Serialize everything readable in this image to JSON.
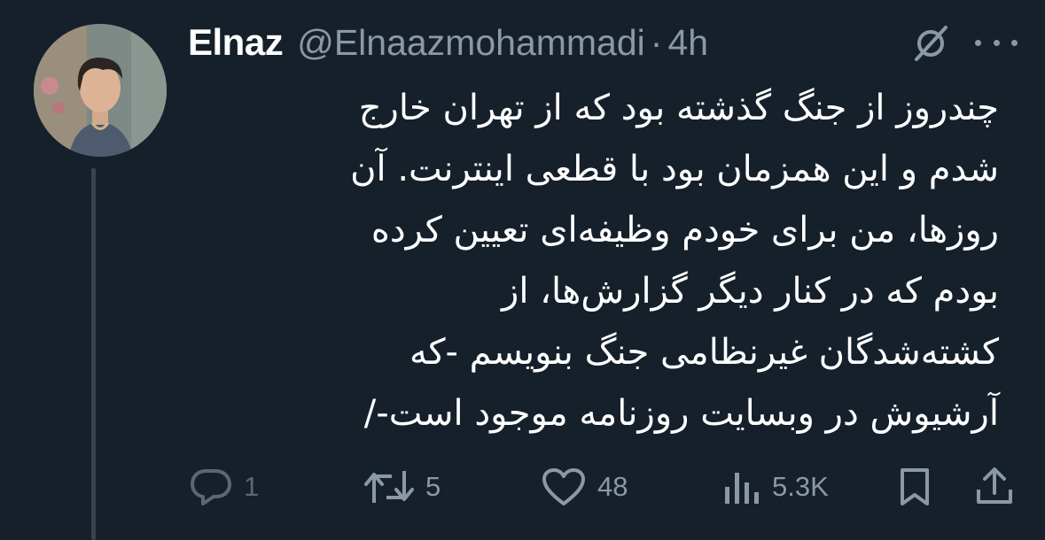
{
  "author": {
    "display_name": "Elnaz",
    "handle": "@Elnaazmohammadi",
    "separator": "·",
    "time": "4h"
  },
  "tweet": {
    "lines": [
      "چندروز از جنگ گذشته بود که از تهران خارج",
      "شدم و این همزمان بود با قطعی اینترنت. آن",
      "روزها، من برای خودم وظیفه‌ای تعیین کرده",
      "بودم که در کنار دیگر گزارش‌ها، از",
      "کشته‌شدگان غیرنظامی جنگ بنویسم -که",
      "آرشیوش در وبسایت روزنامه موجود است-/"
    ]
  },
  "actions": {
    "replies": "1",
    "reposts": "5",
    "likes": "48",
    "views": "5.3K"
  },
  "icons": {
    "header": [
      "grok-icon",
      "more-icon"
    ],
    "actions": [
      "reply-icon",
      "repost-icon",
      "like-icon",
      "views-icon",
      "bookmark-icon",
      "share-icon"
    ]
  },
  "colors": {
    "background": "#15202b",
    "text": "#ffffff",
    "secondary": "#8b98a5",
    "thread_line": "#38444d"
  }
}
